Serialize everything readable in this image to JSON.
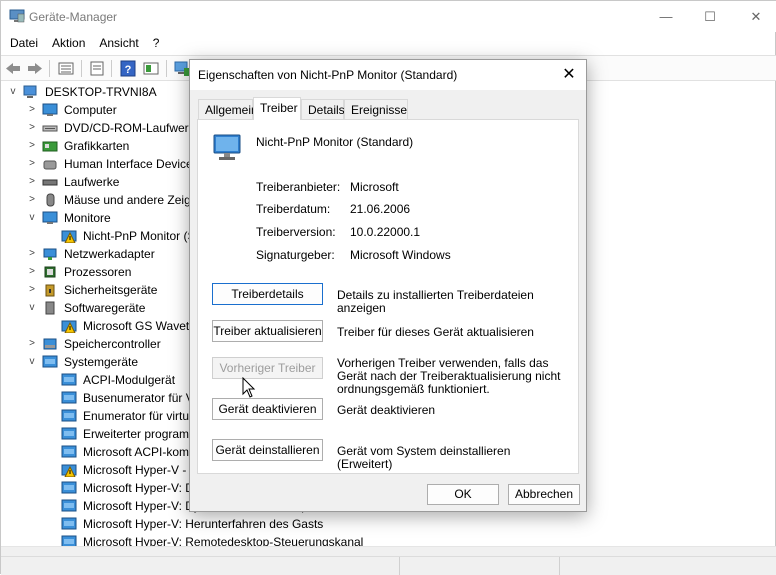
{
  "window": {
    "title": "Geräte-Manager",
    "controls": {
      "minimize": "—",
      "maximize": "☐",
      "close": "✕"
    }
  },
  "menu": [
    "Datei",
    "Aktion",
    "Ansicht",
    "?"
  ],
  "toolbar": {
    "icons": [
      "back-icon",
      "forward-icon",
      "properties-icon",
      "view-icon",
      "help-icon",
      "update-driver-icon",
      "computer-icon"
    ]
  },
  "tree": {
    "items": [
      {
        "label": "DESKTOP-TRVNI8A",
        "expander": "v",
        "icon": "computer-icon"
      },
      {
        "label": "Computer",
        "expander": ">",
        "icon": "monitor-icon"
      },
      {
        "label": "DVD/CD-ROM-Laufwerke",
        "expander": ">",
        "icon": "drive-icon"
      },
      {
        "label": "Grafikkarten",
        "expander": ">",
        "icon": "display-adapter-icon"
      },
      {
        "label": "Human Interface Devices",
        "expander": ">",
        "icon": "hid-icon"
      },
      {
        "label": "Laufwerke",
        "expander": ">",
        "icon": "disk-icon"
      },
      {
        "label": "Mäuse und andere Zeigegeräte",
        "expander": ">",
        "icon": "mouse-icon"
      },
      {
        "label": "Monitore",
        "expander": "v",
        "icon": "monitor-icon"
      },
      {
        "label": "Nicht-PnP Monitor (Standard)",
        "expander": "",
        "icon": "warning-icon"
      },
      {
        "label": "Netzwerkadapter",
        "expander": ">",
        "icon": "network-icon"
      },
      {
        "label": "Prozessoren",
        "expander": ">",
        "icon": "processor-icon"
      },
      {
        "label": "Sicherheitsgeräte",
        "expander": ">",
        "icon": "security-icon"
      },
      {
        "label": "Softwaregeräte",
        "expander": "v",
        "icon": "software-icon"
      },
      {
        "label": "Microsoft GS Wavetable Synth",
        "expander": "",
        "icon": "warning-icon"
      },
      {
        "label": "Speichercontroller",
        "expander": ">",
        "icon": "storage-icon"
      },
      {
        "label": "Systemgeräte",
        "expander": "v",
        "icon": "system-icon"
      },
      {
        "label": "ACPI-Modulgerät",
        "expander": "",
        "icon": "system-icon"
      },
      {
        "label": "Busenumerator für Virtualisierung",
        "expander": "",
        "icon": "system-icon"
      },
      {
        "label": "Enumerator für virtuelle Laufwerke",
        "expander": "",
        "icon": "system-icon"
      },
      {
        "label": "Erweiterter programmierbarer Interruptcontroller",
        "expander": "",
        "icon": "system-icon"
      },
      {
        "label": "Microsoft ACPI-kompatibles System",
        "expander": "",
        "icon": "system-icon"
      },
      {
        "label": "Microsoft Hyper-V - Virtualisierungsinfrastruktur",
        "expander": "",
        "icon": "warning-icon"
      },
      {
        "label": "Microsoft Hyper-V: Datenaustausch",
        "expander": "",
        "icon": "system-icon"
      },
      {
        "label": "Microsoft Hyper-V: Dynamischer Arbeitsspeicher",
        "expander": "",
        "icon": "system-icon"
      },
      {
        "label": "Microsoft Hyper-V: Herunterfahren des Gasts",
        "expander": "",
        "icon": "system-icon"
      },
      {
        "label": "Microsoft Hyper-V: Remotedesktop-Steuerungskanal",
        "expander": "",
        "icon": "system-icon"
      }
    ]
  },
  "dialog": {
    "title": "Eigenschaften von Nicht-PnP Monitor (Standard)",
    "close": "✕",
    "tabs": [
      "Allgemein",
      "Treiber",
      "Details",
      "Ereignisse"
    ],
    "active_tab": "Treiber",
    "device_name": "Nicht-PnP Monitor (Standard)",
    "properties": [
      {
        "label": "Treiberanbieter:",
        "value": "Microsoft"
      },
      {
        "label": "Treiberdatum:",
        "value": "21.06.2006"
      },
      {
        "label": "Treiberversion:",
        "value": "10.0.22000.1"
      },
      {
        "label": "Signaturgeber:",
        "value": "Microsoft Windows"
      }
    ],
    "actions": [
      {
        "label": "Treiberdetails",
        "desc": "Details zu installierten Treiberdateien anzeigen"
      },
      {
        "label": "Treiber aktualisieren",
        "desc": "Treiber für dieses Gerät aktualisieren"
      },
      {
        "label": "Vorheriger Treiber",
        "desc": "Vorherigen Treiber verwenden, falls das Gerät nach der Treiberaktualisierung nicht ordnungsgemäß funktioniert."
      },
      {
        "label": "Gerät deaktivieren",
        "desc": "Gerät deaktivieren"
      },
      {
        "label": "Gerät deinstallieren",
        "desc": "Gerät vom System deinstallieren (Erweitert)"
      }
    ],
    "ok": "OK",
    "cancel": "Abbrechen"
  },
  "colors": {
    "accent": "#1a6fce",
    "warning": "#f5c400",
    "monitor": "#3a8fd8"
  }
}
